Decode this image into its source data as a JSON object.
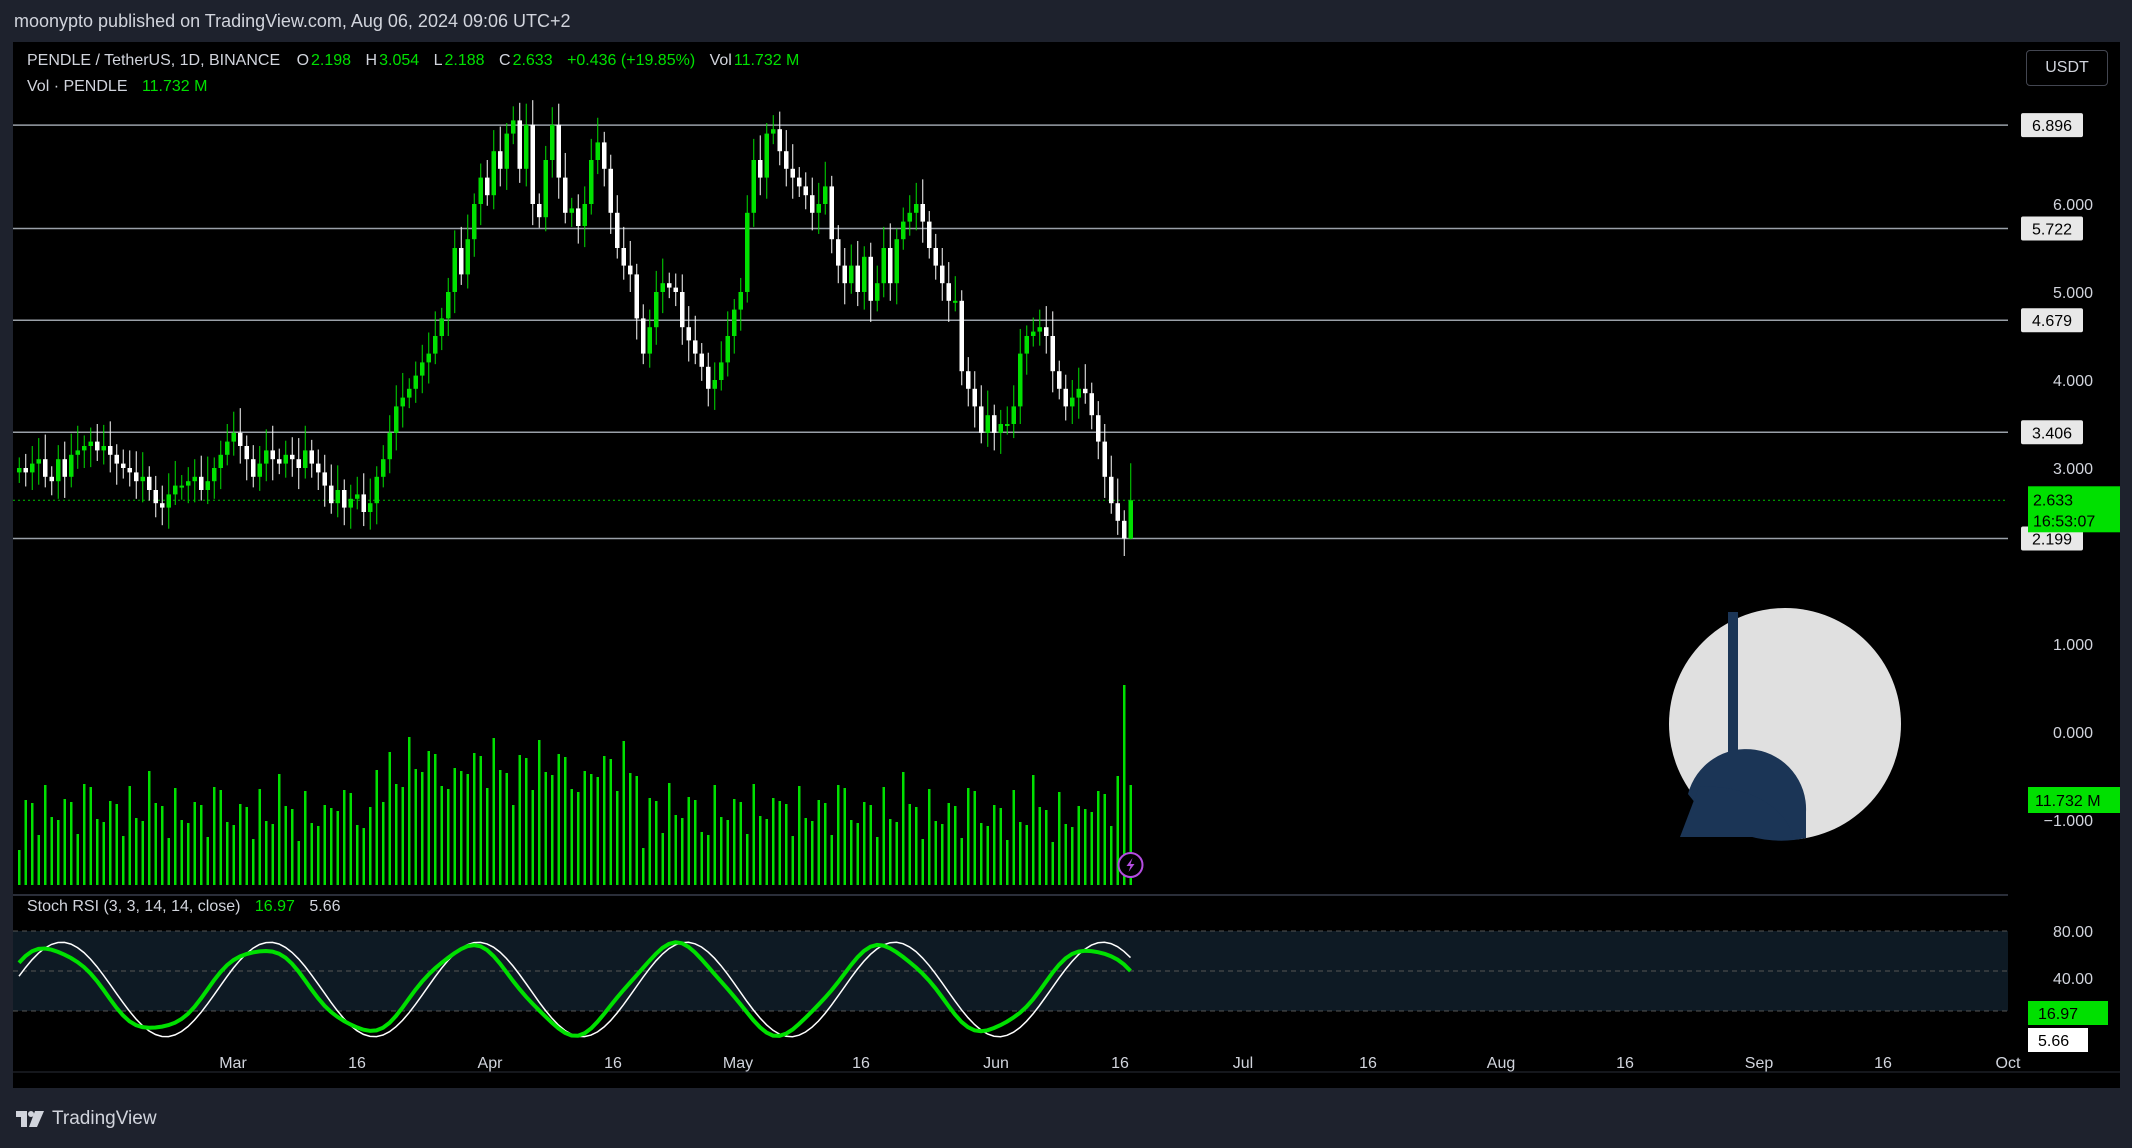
{
  "header": {
    "published": "moonypto published on TradingView.com, Aug 06, 2024 09:06 UTC+2"
  },
  "legend": {
    "symbol": "PENDLE / TetherUS, 1D, BINANCE",
    "o_label": "O",
    "o_value": "2.198",
    "h_label": "H",
    "h_value": "3.054",
    "l_label": "L",
    "l_value": "2.188",
    "c_label": "C",
    "c_value": "2.633",
    "change": "+0.436 (+19.85%)",
    "vol_label": "Vol",
    "vol_value": "11.732 M",
    "vol_line_label": "Vol · PENDLE",
    "vol_line_value": "11.732 M"
  },
  "currency_button": "USDT",
  "price_scale": {
    "ticks": [
      "6.000",
      "5.000",
      "4.000",
      "3.000",
      "1.000",
      "0.000",
      "−1.000"
    ],
    "tick_values": [
      6,
      5,
      4,
      3,
      1,
      0,
      -1
    ],
    "levels": [
      {
        "label": "6.896",
        "value": 6.896
      },
      {
        "label": "5.722",
        "value": 5.722
      },
      {
        "label": "4.679",
        "value": 4.679
      },
      {
        "label": "3.406",
        "value": 3.406
      },
      {
        "label": "2.199",
        "value": 2.199
      }
    ],
    "last_price": "2.633",
    "countdown": "16:53:07",
    "volume_label": "11.732 M"
  },
  "stoch": {
    "title": "Stoch RSI (3, 3, 14, 14, close)",
    "k_value": "16.97",
    "d_value": "5.66",
    "ticks": [
      "80.00",
      "40.00"
    ],
    "k_label": "16.97",
    "d_label": "5.66"
  },
  "time_axis": [
    "Mar",
    "16",
    "Apr",
    "16",
    "May",
    "16",
    "Jun",
    "16",
    "Jul",
    "16",
    "Aug",
    "16",
    "Sep",
    "16",
    "Oct"
  ],
  "footer": {
    "brand": "TradingView"
  },
  "colors": {
    "up": "#00e000",
    "down": "#ffffff",
    "background": "#000000",
    "panel": "#1e222d",
    "stoch_band": "#0e1a24"
  },
  "chart_data": {
    "type": "candlestick",
    "title": "PENDLE / TetherUS, 1D, BINANCE",
    "ylim": [
      -1.5,
      7.3
    ],
    "ohlc_last": {
      "o": 2.198,
      "h": 3.054,
      "l": 2.188,
      "c": 2.633
    },
    "levels": [
      6.896,
      5.722,
      4.679,
      3.406,
      2.199
    ],
    "closes": [
      3.0,
      2.95,
      3.05,
      3.1,
      2.9,
      2.85,
      3.1,
      2.9,
      3.15,
      3.2,
      3.25,
      3.3,
      3.2,
      3.25,
      3.15,
      3.05,
      3.0,
      2.95,
      2.85,
      2.9,
      2.75,
      2.6,
      2.55,
      2.7,
      2.8,
      2.8,
      2.85,
      2.9,
      2.75,
      2.85,
      3.0,
      3.15,
      3.3,
      3.4,
      3.25,
      3.1,
      2.9,
      3.05,
      3.2,
      3.1,
      3.05,
      3.15,
      3.1,
      3.0,
      3.2,
      3.05,
      2.95,
      2.8,
      2.6,
      2.75,
      2.55,
      2.65,
      2.7,
      2.5,
      2.6,
      2.9,
      3.1,
      3.4,
      3.7,
      3.8,
      3.9,
      4.05,
      4.2,
      4.3,
      4.5,
      4.7,
      5.0,
      5.5,
      5.2,
      5.6,
      6.0,
      6.3,
      6.1,
      6.6,
      6.4,
      6.8,
      6.95,
      6.4,
      6.9,
      6.0,
      5.85,
      6.5,
      6.9,
      6.3,
      5.9,
      5.95,
      5.75,
      6.0,
      6.5,
      6.7,
      6.4,
      5.9,
      5.5,
      5.3,
      5.2,
      4.7,
      4.3,
      4.6,
      5.0,
      5.1,
      5.05,
      5.0,
      4.6,
      4.45,
      4.3,
      4.15,
      3.9,
      4.0,
      4.2,
      4.5,
      4.8,
      5.0,
      5.9,
      6.5,
      6.3,
      6.8,
      6.85,
      6.6,
      6.4,
      6.3,
      6.2,
      6.1,
      5.9,
      6.0,
      6.2,
      5.6,
      5.3,
      5.1,
      5.3,
      5.0,
      5.4,
      4.9,
      5.1,
      5.5,
      5.1,
      5.6,
      5.8,
      5.9,
      6.0,
      5.8,
      5.5,
      5.3,
      5.1,
      4.9,
      4.9,
      4.1,
      3.9,
      3.7,
      3.4,
      3.6,
      3.4,
      3.5,
      3.5,
      3.7,
      4.3,
      4.5,
      4.55,
      4.6,
      4.5,
      4.1,
      3.9,
      3.7,
      3.8,
      3.9,
      3.85,
      3.6,
      3.3,
      2.9,
      2.6,
      2.4,
      2.2,
      2.633
    ]
  }
}
